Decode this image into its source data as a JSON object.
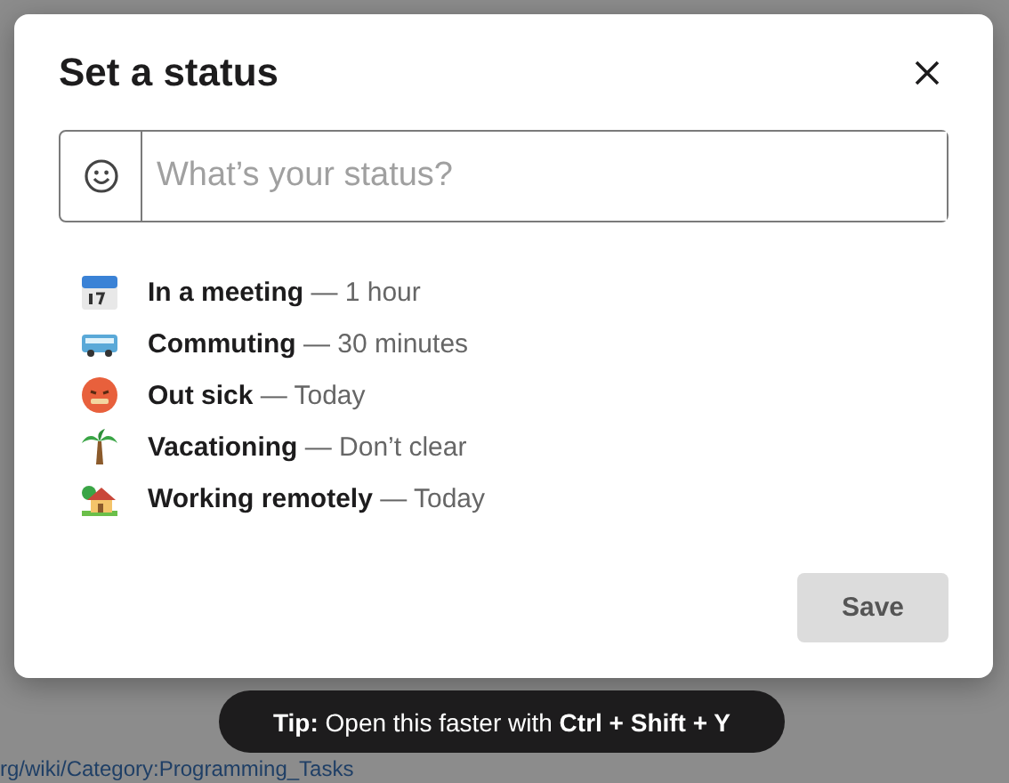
{
  "background": {
    "bottom_link": "rg/wiki/Category:Programming_Tasks"
  },
  "dialog": {
    "title": "Set a status",
    "input": {
      "placeholder": "What’s your status?"
    },
    "presets": [
      {
        "kind": "calendar",
        "label": "**In a meeting** — 1 hour"
      },
      {
        "kind": "bus",
        "label": "**Commuting** — 30 minutes"
      },
      {
        "kind": "sick-face",
        "label": "**Out sick** — Today"
      },
      {
        "kind": "palm-tree",
        "label": "**Vacationing** — Don’t clear"
      },
      {
        "kind": "house",
        "label": "**Working remotely** — Today"
      }
    ],
    "save_button": "Save"
  },
  "tip": "**Tip:** Open this faster with **Ctrl + Shift + Y**"
}
